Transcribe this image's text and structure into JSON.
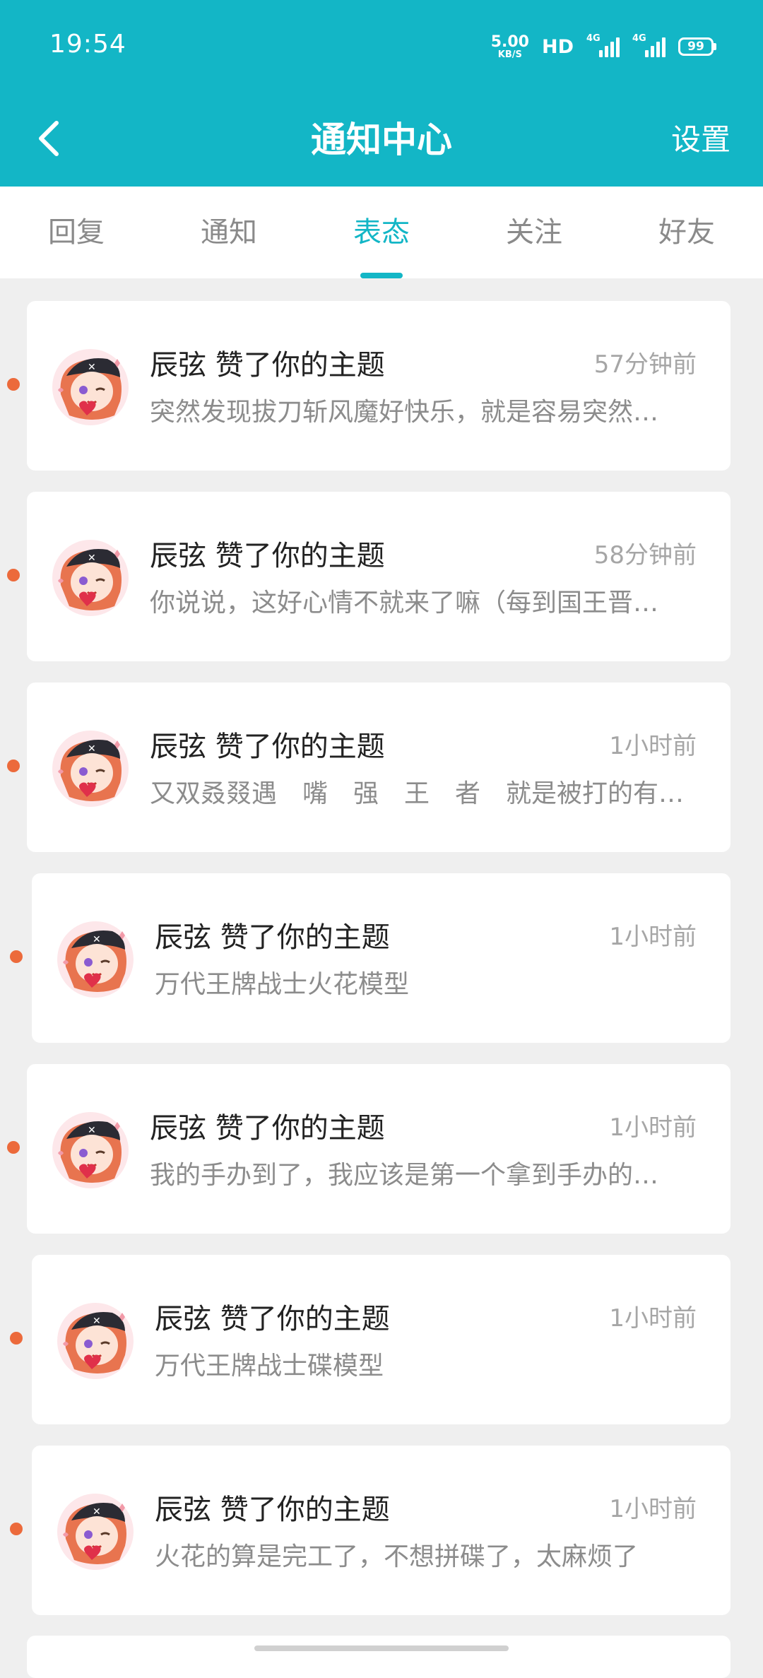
{
  "status_bar": {
    "time": "19:54",
    "net_speed_value": "5.00",
    "net_speed_unit": "KB/S",
    "hd": "HD",
    "signal1_label": "4G",
    "signal2_label": "4G",
    "battery": "99"
  },
  "header": {
    "title": "通知中心",
    "settings": "设置"
  },
  "tabs": [
    {
      "label": "回复"
    },
    {
      "label": "通知"
    },
    {
      "label": "表态"
    },
    {
      "label": "关注"
    },
    {
      "label": "好友"
    }
  ],
  "active_tab": "表态",
  "notifications": [
    {
      "user": "辰弦",
      "action": "赞了你的主题",
      "title": "辰弦 赞了你的主题",
      "time": "57分钟前",
      "text": "突然发现拔刀斩风魔好快乐，就是容易突然…",
      "unread": true
    },
    {
      "user": "辰弦",
      "action": "赞了你的主题",
      "title": "辰弦 赞了你的主题",
      "time": "58分钟前",
      "text": "你说说，这好心情不就来了嘛（每到国王晋…",
      "unread": true
    },
    {
      "user": "辰弦",
      "action": "赞了你的主题",
      "title": "辰弦 赞了你的主题",
      "time": "1小时前",
      "text": "又双叒叕遇　嘴　强　王　者　就是被打的有…",
      "unread": true
    },
    {
      "user": "辰弦",
      "action": "赞了你的主题",
      "title": "辰弦 赞了你的主题",
      "time": "1小时前",
      "text": "万代王牌战士火花模型",
      "unread": true
    },
    {
      "user": "辰弦",
      "action": "赞了你的主题",
      "title": "辰弦 赞了你的主题",
      "time": "1小时前",
      "text": "我的手办到了，我应该是第一个拿到手办的…",
      "unread": true
    },
    {
      "user": "辰弦",
      "action": "赞了你的主题",
      "title": "辰弦 赞了你的主题",
      "time": "1小时前",
      "text": "万代王牌战士碟模型",
      "unread": true
    },
    {
      "user": "辰弦",
      "action": "赞了你的主题",
      "title": "辰弦 赞了你的主题",
      "time": "1小时前",
      "text": "火花的算是完工了，不想拼碟了，太麻烦了",
      "unread": true
    }
  ],
  "colors": {
    "accent": "#13b6c6",
    "unread_dot": "#ec6a3b",
    "background": "#efefef"
  }
}
